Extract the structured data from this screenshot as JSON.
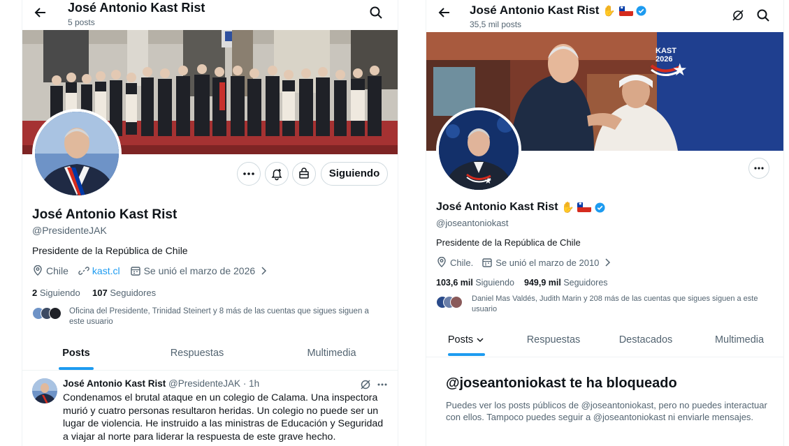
{
  "left": {
    "header": {
      "name": "José Antonio Kast Rist",
      "posts_count": "5 posts"
    },
    "profile": {
      "name": "José Antonio Kast Rist",
      "handle": "@PresidenteJAK",
      "bio": "Presidente de la República de Chile",
      "location": "Chile",
      "website": "kast.cl",
      "joined": "Se unió el marzo de 2026",
      "following_count": "2",
      "following_label": "Siguiendo",
      "followers_count": "107",
      "followers_label": "Seguidores",
      "followed_by_note": "Oficina del Presidente, Trinidad Steinert y 8 más de las cuentas que sigues siguen a este usuario",
      "following_button": "Siguiendo"
    },
    "tabs": [
      "Posts",
      "Respuestas",
      "Multimedia"
    ],
    "post": {
      "author": "José Antonio Kast Rist",
      "handle": "@PresidenteJAK",
      "separator": "·",
      "time": "1h",
      "text": "Condenamos el brutal ataque en un colegio de Calama. Una inspectora murió y cuatro personas resultaron heridas. Un colegio no puede ser un lugar de violencia. He instruido a las ministras de Educación y Seguridad a viajar al norte para liderar la respuesta de este grave hecho."
    },
    "colors": {
      "accent": "#1d9bf0",
      "link": "#1d9bf0"
    }
  },
  "right": {
    "header": {
      "name": "José Antonio Kast Rist",
      "posts_count": "35,5 mil posts",
      "emoji_hand": "✋"
    },
    "banner": {
      "logo_text": "KAST",
      "logo_year": "2026"
    },
    "profile": {
      "name": "José Antonio Kast Rist",
      "emoji_hand": "✋",
      "handle": "@joseantoniokast",
      "bio": "Presidente de la República de Chile",
      "location": "Chile.",
      "joined": "Se unió el marzo de 2010",
      "following_count": "103,6 mil",
      "following_label": "Siguiendo",
      "followers_count": "949,9 mil",
      "followers_label": "Seguidores",
      "followed_by_note": "Daniel Mas Valdés, Judith Marin y 208 más de las cuentas que sigues siguen a este usuario"
    },
    "tabs": [
      "Posts",
      "Respuestas",
      "Destacados",
      "Multimedia"
    ],
    "blocked": {
      "title": "@joseantoniokast te ha bloqueado",
      "message": "Puedes ver los posts públicos de @joseantoniokast, pero no puedes interactuar con ellos. Tampoco puedes seguir a @joseantoniokast ni enviarle mensajes."
    },
    "colors": {
      "verified": "#1d9bf0",
      "banner_blue": "#1f3f8f"
    }
  }
}
